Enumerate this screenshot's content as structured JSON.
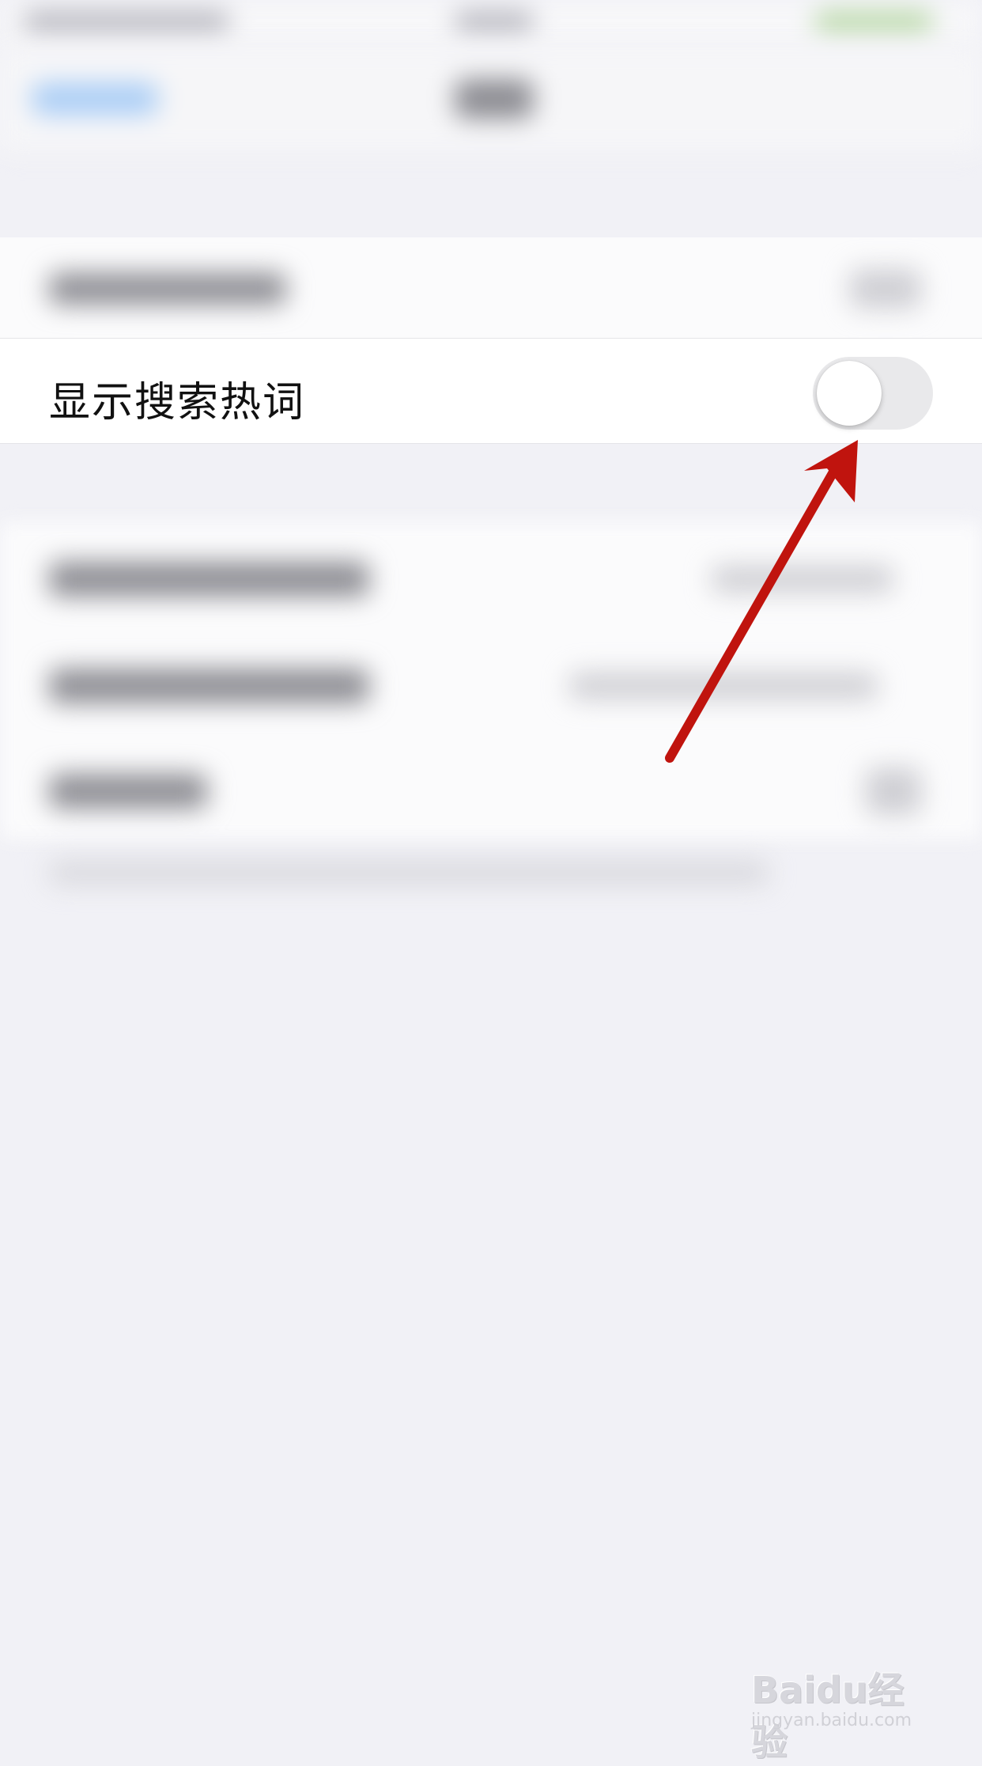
{
  "settings": {
    "show_hot_search_label": "显示搜索热词",
    "show_hot_search_enabled": false
  },
  "colors": {
    "background": "#f1f1f6",
    "row_background": "#ffffff",
    "toggle_off": "#e9e9eb",
    "arrow": "#c0140e",
    "nav_accent": "#a9cdf6"
  },
  "watermark": {
    "brand": "Baidu经验",
    "url": "jingyan.baidu.com"
  }
}
